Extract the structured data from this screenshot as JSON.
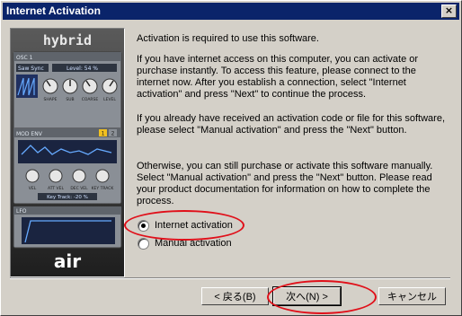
{
  "window": {
    "title": "Internet Activation",
    "close_glyph": "×"
  },
  "panel": {
    "logo_top": "hybrid",
    "osc_label": "OSC 1",
    "osc_wave": "Saw Sync",
    "osc_level": "Level: 54 %",
    "osc_knobs": [
      "SHAPE",
      "SUB",
      "COARSE",
      "LEVEL"
    ],
    "mod_label": "MOD ENV",
    "mod_tabs": [
      "1",
      "2"
    ],
    "mod_knobs": [
      "VEL",
      "ATT VEL",
      "DEC VEL",
      "KEY TRACK"
    ],
    "key_track": "Key Track: -20 %",
    "lfo_label": "LFO",
    "logo_bottom": "air"
  },
  "content": {
    "p1": "Activation is required to use this software.",
    "p2": "If you have internet access on this computer, you can activate or purchase instantly.  To access this feature, please connect to the internet now.  After you establish a connection, select \"Internet activation\" and press \"Next\" to continue the process.",
    "p3": "If you already have received an activation code or file for this software, please select \"Manual activation\" and press the \"Next\" button.",
    "p4": "Otherwise, you can still purchase or activate this software manually.  Select \"Manual activation\" and press the \"Next\" button.  Please read your product documentation for information on how to complete the process."
  },
  "options": [
    {
      "label": "Internet activation",
      "selected": true
    },
    {
      "label": "Manual activation",
      "selected": false
    }
  ],
  "buttons": {
    "back": "< 戻る(B)",
    "next": "次へ(N) >",
    "cancel": "キャンセル"
  }
}
